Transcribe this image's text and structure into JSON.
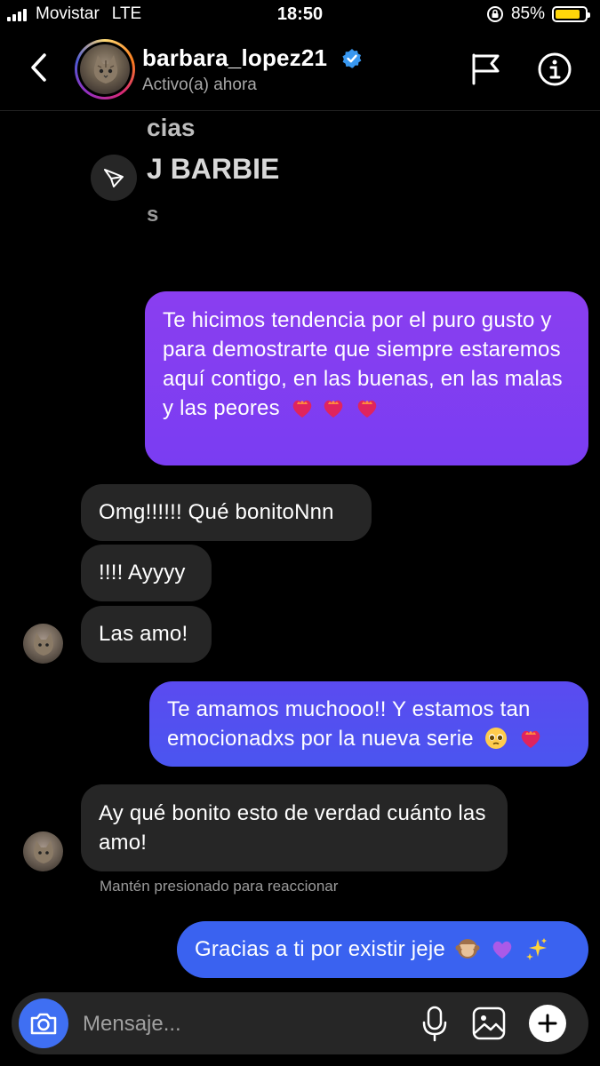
{
  "status_bar": {
    "carrier": "Movistar",
    "network": "LTE",
    "time": "18:50",
    "battery": "85%",
    "battery_level": 0.85
  },
  "header": {
    "username": "barbara_lopez21",
    "activity": "Activo(a) ahora",
    "verified": true,
    "icons": [
      "chevron-left-icon",
      "flag-icon",
      "info-icon"
    ]
  },
  "shared_post": {
    "line1": "cias",
    "line2": "J BARBIE",
    "line3": "s"
  },
  "messages": [
    {
      "from": "me",
      "text": "Te hicimos tendencia por el puro gusto y para demostrarte que siempre estaremos aquí contigo, en las buenas, en las malas y las peores",
      "emoji": [
        "heart-on-fire",
        "heart-on-fire",
        "heart-on-fire"
      ]
    },
    {
      "from": "them",
      "text": "Omg!!!!!! Qué bonitoNnn"
    },
    {
      "from": "them",
      "text": "!!!! Ayyyy"
    },
    {
      "from": "them",
      "text": "Las amo!"
    },
    {
      "from": "me",
      "line1": "Te amamos muchooo!! Y estamos tan",
      "line2": "emocionadxs por la nueva serie",
      "emoji": [
        "pleading-face",
        "heart-on-fire"
      ]
    },
    {
      "from": "them",
      "text": "Ay qué bonito esto de verdad cuánto las amo!"
    },
    {
      "from": "me",
      "text": "Gracias a ti por existir jeje",
      "emoji": [
        "see-no-evil-monkey",
        "purple-heart",
        "sparkles"
      ]
    }
  ],
  "hint": "Mantén presionado para reaccionar",
  "composer": {
    "placeholder": "Mensaje..."
  },
  "colors": {
    "purple_bubble": "#8a3ef0",
    "blue_bubble": "#3a62f0",
    "incoming_bubble": "#262626",
    "camera": "#3f6ff2",
    "verified": "#3897f0"
  }
}
